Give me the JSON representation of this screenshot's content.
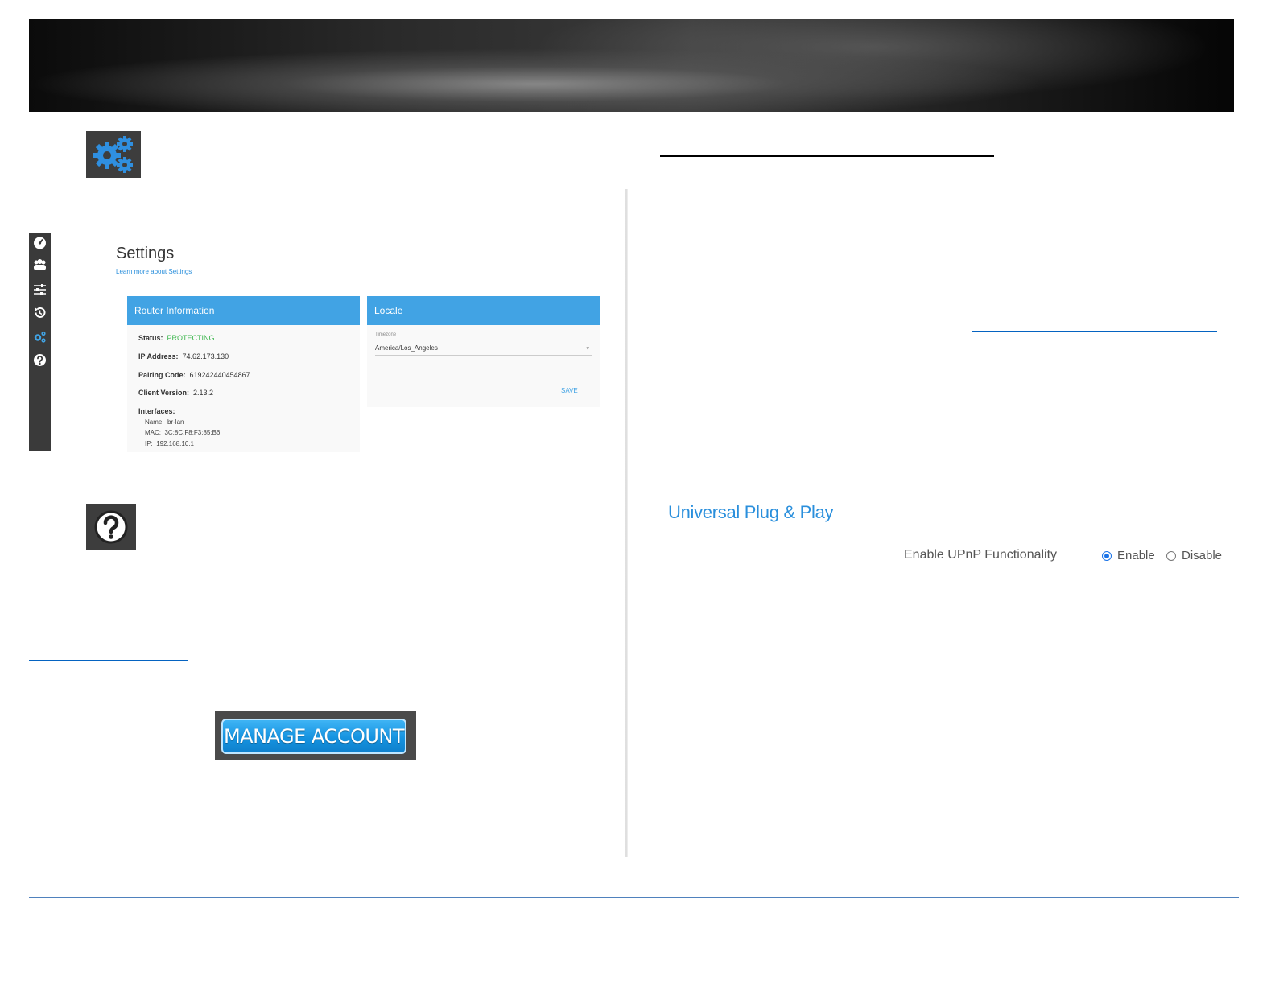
{
  "settings_screen": {
    "title": "Settings",
    "learn_more": "Learn more about Settings",
    "router_info": {
      "header": "Router Information",
      "status_label": "Status:",
      "status_value": "PROTECTING",
      "ip_label": "IP Address:",
      "ip_value": "74.62.173.130",
      "pairing_label": "Pairing Code:",
      "pairing_value": "619242440454867",
      "client_label": "Client Version:",
      "client_value": "2.13.2",
      "interfaces_label": "Interfaces:",
      "iface_name_label": "Name:",
      "iface_name_value": "br-lan",
      "iface_mac_label": "MAC:",
      "iface_mac_value": "3C:8C:F8:F3:85:B6",
      "iface_ip_label": "IP:",
      "iface_ip_value": "192.168.10.1"
    },
    "locale": {
      "header": "Locale",
      "timezone_label": "Timezone",
      "timezone_value": "America/Los_Angeles",
      "save_label": "SAVE"
    }
  },
  "upnp": {
    "title": "Universal Plug & Play",
    "label": "Enable UPnP Functionality",
    "enable_label": "Enable",
    "disable_label": "Disable",
    "selected": "Enable"
  },
  "manage_account": {
    "label": "MANAGE ACCOUNT"
  },
  "colors": {
    "accent": "#41a3e4",
    "status_green": "#39b54a",
    "link_blue": "#0563c1",
    "footer_line": "#4f81bd"
  },
  "icons": {
    "settings_tile": "gears-icon",
    "help_tile": "question-circle-icon",
    "rail": [
      "dashboard-gauge-icon",
      "people-icon",
      "sliders-icon",
      "history-icon",
      "gears-icon",
      "help-icon"
    ]
  }
}
